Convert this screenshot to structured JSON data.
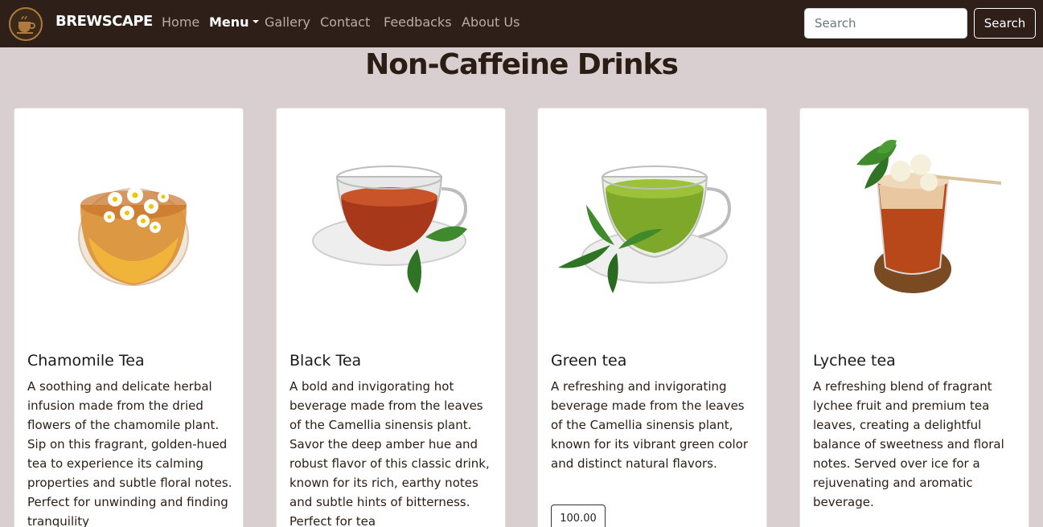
{
  "navbar": {
    "brand": "BREWSCAPE",
    "links": [
      {
        "label": "Home"
      },
      {
        "label": "Menu"
      },
      {
        "label": "Gallery"
      },
      {
        "label": "Contact"
      },
      {
        "label": "Feedbacks"
      },
      {
        "label": "About Us"
      }
    ],
    "search": {
      "placeholder": "Search",
      "button_label": "Search"
    },
    "colors": {
      "background": "#2e2018"
    }
  },
  "page": {
    "title": "Non-Caffeine Drinks",
    "background": "#d9cfd0"
  },
  "cards": [
    {
      "title": "Chamomile Tea",
      "description": "A soothing and delicate herbal infusion made from the dried flowers of the chamomile plant. Sip on this fragrant, golden-hued tea to experience its calming properties and subtle floral notes. Perfect for unwinding and finding tranquility",
      "image": "chamomile-tea-glass"
    },
    {
      "title": "Black Tea",
      "description": "A bold and invigorating hot beverage made from the leaves of the Camellia sinensis plant. Savor the deep amber hue and robust flavor of this classic drink, known for its rich, earthy notes and subtle hints of bitterness. Perfect for tea",
      "image": "black-tea-cup"
    },
    {
      "title": "Green tea",
      "description": "A refreshing and invigorating beverage made from the leaves of the Camellia sinensis plant, known for its vibrant green color and distinct natural flavors.",
      "price": "100.00",
      "image": "green-tea-cup"
    },
    {
      "title": "Lychee tea",
      "description": "A refreshing blend of fragrant lychee fruit and premium tea leaves, creating a delightful balance of sweetness and floral notes. Served over ice for a rejuvenating and aromatic beverage.",
      "image": "lychee-iced-tea"
    }
  ]
}
